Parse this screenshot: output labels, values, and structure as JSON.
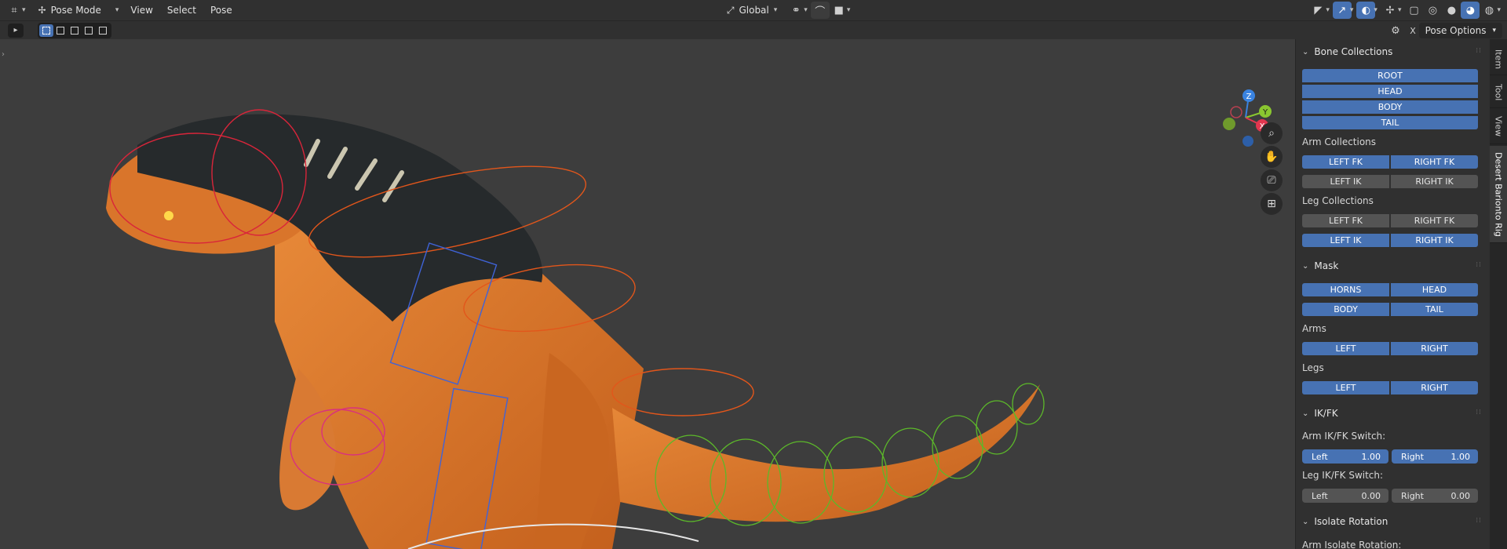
{
  "header": {
    "mode": "Pose Mode",
    "menus": [
      "View",
      "Select",
      "Pose"
    ],
    "orientation": "Global"
  },
  "toolbar": {
    "pose_options": "Pose Options",
    "close_label": "X"
  },
  "tabs": [
    "Item",
    "Tool",
    "View",
    "Desert Barionto Rig"
  ],
  "gizmo": {
    "z": "Z",
    "y": "Y",
    "x": "X"
  },
  "panel": {
    "bone_collections": {
      "title": "Bone Collections",
      "items": [
        "ROOT",
        "HEAD",
        "BODY",
        "TAIL"
      ],
      "arm_label": "Arm Collections",
      "arm_rows": [
        [
          "LEFT FK",
          "RIGHT FK"
        ],
        [
          "LEFT IK",
          "RIGHT IK"
        ]
      ],
      "leg_label": "Leg Collections",
      "leg_rows": [
        [
          "LEFT FK",
          "RIGHT FK"
        ],
        [
          "LEFT IK",
          "RIGHT IK"
        ]
      ]
    },
    "mask": {
      "title": "Mask",
      "row1": [
        "HORNS",
        "HEAD"
      ],
      "row2": [
        "BODY",
        "TAIL"
      ],
      "arms_label": "Arms",
      "arms": [
        "LEFT",
        "RIGHT"
      ],
      "legs_label": "Legs",
      "legs": [
        "LEFT",
        "RIGHT"
      ]
    },
    "ikfk": {
      "title": "IK/FK",
      "arm_label": "Arm IK/FK Switch:",
      "arm_left_label": "Left",
      "arm_left_value": "1.00",
      "arm_right_label": "Right",
      "arm_right_value": "1.00",
      "leg_label": "Leg IK/FK Switch:",
      "leg_left_label": "Left",
      "leg_left_value": "0.00",
      "leg_right_label": "Right",
      "leg_right_value": "0.00"
    },
    "isolate": {
      "title": "Isolate Rotation",
      "arm_label": "Arm Isolate Rotation:"
    }
  },
  "colors": {
    "accent": "#4772b3",
    "panel_bg": "#303030",
    "viewport_bg": "#3d3d3d",
    "button_off": "#545454",
    "axis_x": "#e3364f",
    "axis_y": "#8ac630",
    "axis_z": "#3a83e0"
  }
}
